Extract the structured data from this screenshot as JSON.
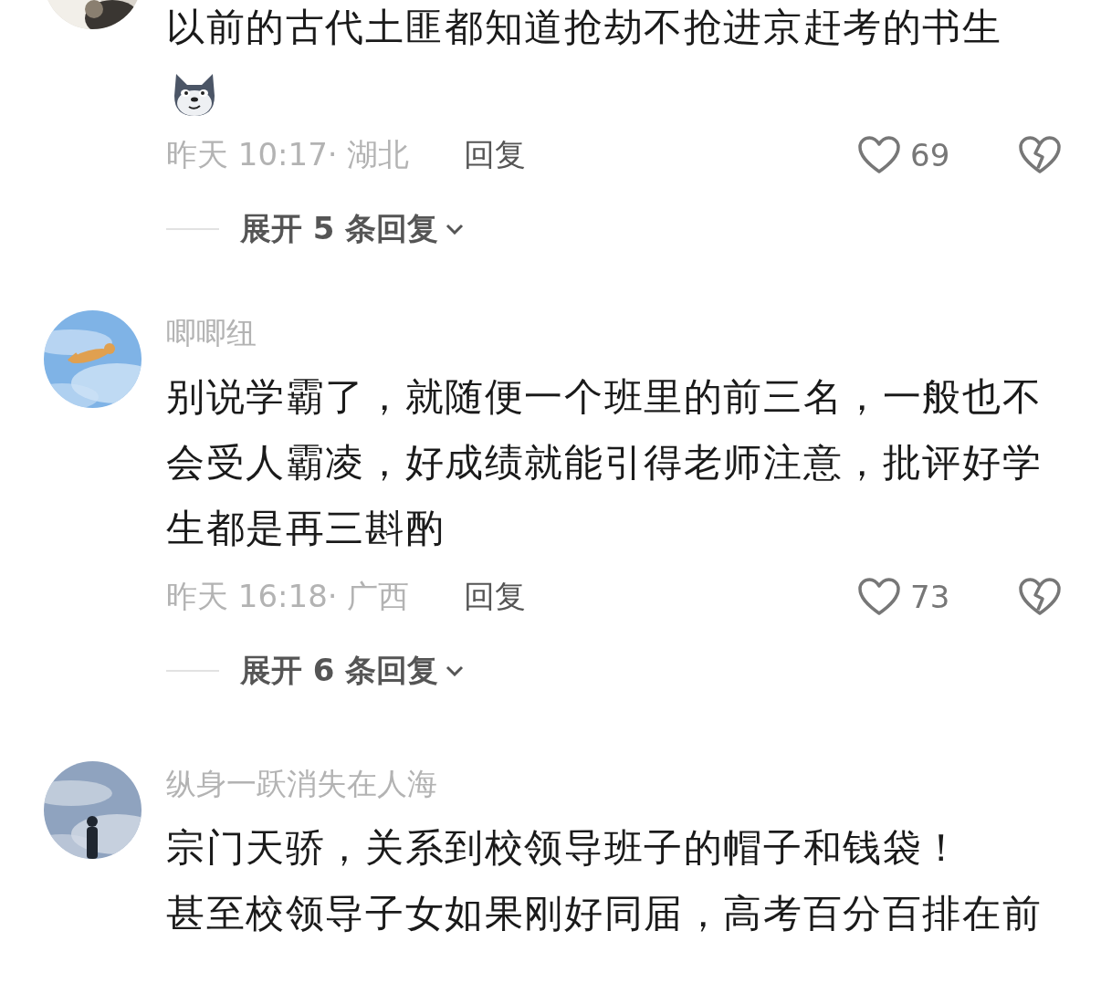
{
  "comments": [
    {
      "avatar": {
        "kind": "picture",
        "cut": true
      },
      "body": [
        "以前的古代土匪都知道抢劫不抢进京赶考的书生"
      ],
      "sticker": true,
      "time": "昨天 10:17· 湖北",
      "reply": "回复",
      "likes": "69",
      "expand": "展开 5 条回复"
    },
    {
      "avatar": {
        "kind": "picture",
        "cut": false
      },
      "name": "唧唧纽",
      "body": [
        "别说学霸了，就随便一个班里的前三名，一般也不会受人霸凌，好成绩就能引得老师注意，批评好学生都是再三斟酌"
      ],
      "time": "昨天 16:18· 广西",
      "reply": "回复",
      "likes": "73",
      "expand": "展开 6 条回复"
    },
    {
      "avatar": {
        "kind": "picture",
        "cut": false
      },
      "name": "纵身一跃消失在人海",
      "body": [
        "宗门天骄，关系到校领导班子的帽子和钱袋！",
        "甚至校领导子女如果刚好同届，高考百分百排在前"
      ]
    }
  ]
}
